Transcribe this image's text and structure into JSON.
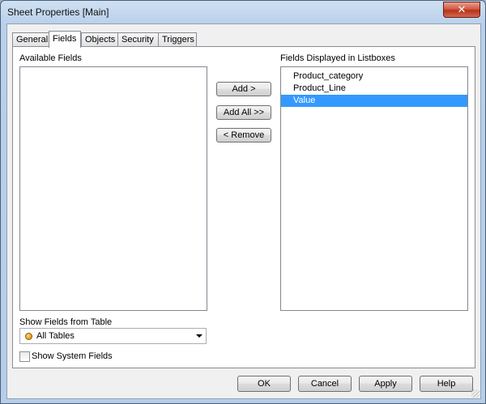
{
  "window": {
    "title": "Sheet Properties [Main]",
    "close_glyph": "✕"
  },
  "tabs": [
    {
      "label": "General"
    },
    {
      "label": "Fields",
      "active": true
    },
    {
      "label": "Objects"
    },
    {
      "label": "Security"
    },
    {
      "label": "Triggers"
    }
  ],
  "fields_tab": {
    "available_label": "Available Fields",
    "available_items": [],
    "displayed_label": "Fields Displayed in Listboxes",
    "displayed_items": [
      {
        "label": "Product_category",
        "selected": false
      },
      {
        "label": "Product_Line",
        "selected": false
      },
      {
        "label": "Value",
        "selected": true
      }
    ],
    "add_label": "Add >",
    "add_all_label": "Add All >>",
    "remove_label": "< Remove",
    "show_from_table_label": "Show Fields from Table",
    "table_select": {
      "value": "All Tables",
      "icon": "table-dot-icon",
      "dot_color": "#e0a020"
    },
    "show_system_fields_label": "Show System Fields",
    "show_system_fields_checked": false
  },
  "footer": {
    "ok_label": "OK",
    "cancel_label": "Cancel",
    "apply_label": "Apply",
    "help_label": "Help"
  },
  "colors": {
    "selection": "#3399ff",
    "close_button": "#c7402a"
  }
}
